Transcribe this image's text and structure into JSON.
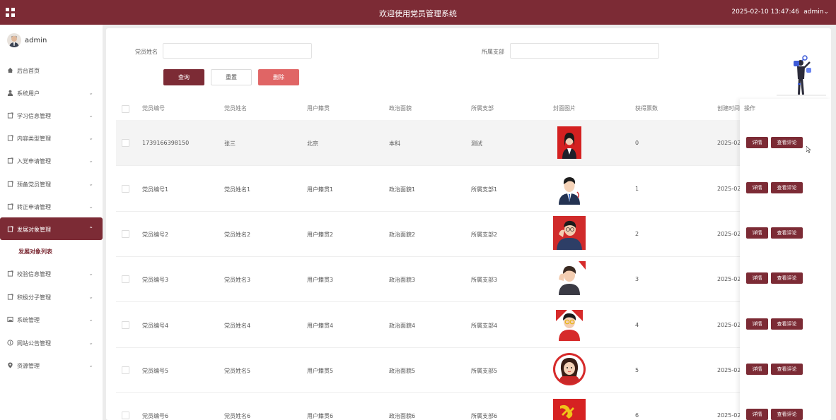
{
  "header": {
    "title": "欢迎使用党员管理系统",
    "datetime": "2025-02-10 13:47:46",
    "user": "admin"
  },
  "sidebar": {
    "username": "admin",
    "items": [
      {
        "label": "后台首页",
        "icon": "home-icon",
        "chevron": ""
      },
      {
        "label": "系统用户",
        "icon": "user-icon",
        "chevron": "⌄"
      },
      {
        "label": "学习信息管理",
        "icon": "doc-icon",
        "chevron": "⌄"
      },
      {
        "label": "内容类型管理",
        "icon": "doc-icon",
        "chevron": "⌄"
      },
      {
        "label": "入党申请管理",
        "icon": "doc-icon",
        "chevron": "⌄"
      },
      {
        "label": "预备党员管理",
        "icon": "doc-icon",
        "chevron": "⌄"
      },
      {
        "label": "转正申请管理",
        "icon": "doc-icon",
        "chevron": "⌄"
      },
      {
        "label": "发展对象管理",
        "icon": "doc-icon",
        "chevron": "⌃"
      },
      {
        "label": "积极分子管理",
        "icon": "doc-icon",
        "chevron": "⌄"
      },
      {
        "label": "系统管理",
        "icon": "image-icon",
        "chevron": "⌄"
      },
      {
        "label": "网站公告管理",
        "icon": "info-icon",
        "chevron": "⌄"
      },
      {
        "label": "资源管理",
        "icon": "pin-icon",
        "chevron": "⌄"
      }
    ],
    "submenu_label": "发展对象列表",
    "extra_item": "校验信息管理"
  },
  "filters": {
    "name_label": "党员姓名",
    "name_value": "",
    "branch_label": "所属支部",
    "branch_value": ""
  },
  "buttons": {
    "query": "查询",
    "reset": "重置",
    "delete": "删除"
  },
  "table": {
    "headers": [
      "党员编号",
      "党员姓名",
      "用户籍贯",
      "政治面貌",
      "所属支部",
      "封面图片",
      "获得票数",
      "创建时间",
      "操作"
    ],
    "rows": [
      {
        "id": "1739166398150",
        "name": "张三",
        "hometown": "北京",
        "political": "本科",
        "branch": "测试",
        "votes": "0",
        "created": "2025-02"
      },
      {
        "id": "党员编号1",
        "name": "党员姓名1",
        "hometown": "用户籍贯1",
        "political": "政治面貌1",
        "branch": "所属支部1",
        "votes": "1",
        "created": "2025-02"
      },
      {
        "id": "党员编号2",
        "name": "党员姓名2",
        "hometown": "用户籍贯2",
        "political": "政治面貌2",
        "branch": "所属支部2",
        "votes": "2",
        "created": "2025-02"
      },
      {
        "id": "党员编号3",
        "name": "党员姓名3",
        "hometown": "用户籍贯3",
        "political": "政治面貌3",
        "branch": "所属支部3",
        "votes": "3",
        "created": "2025-02"
      },
      {
        "id": "党员编号4",
        "name": "党员姓名4",
        "hometown": "用户籍贯4",
        "political": "政治面貌4",
        "branch": "所属支部4",
        "votes": "4",
        "created": "2025-02"
      },
      {
        "id": "党员编号5",
        "name": "党员姓名5",
        "hometown": "用户籍贯5",
        "political": "政治面貌5",
        "branch": "所属支部5",
        "votes": "5",
        "created": "2025-02"
      },
      {
        "id": "党员编号6",
        "name": "党员姓名6",
        "hometown": "用户籍贯6",
        "political": "政治面貌6",
        "branch": "所属支部6",
        "votes": "6",
        "created": "2025-02"
      }
    ],
    "op_detail": "详情",
    "op_comments": "查看评论"
  },
  "colors": {
    "primary": "#7c2b35",
    "danger": "#e06565",
    "background": "#ececec"
  }
}
